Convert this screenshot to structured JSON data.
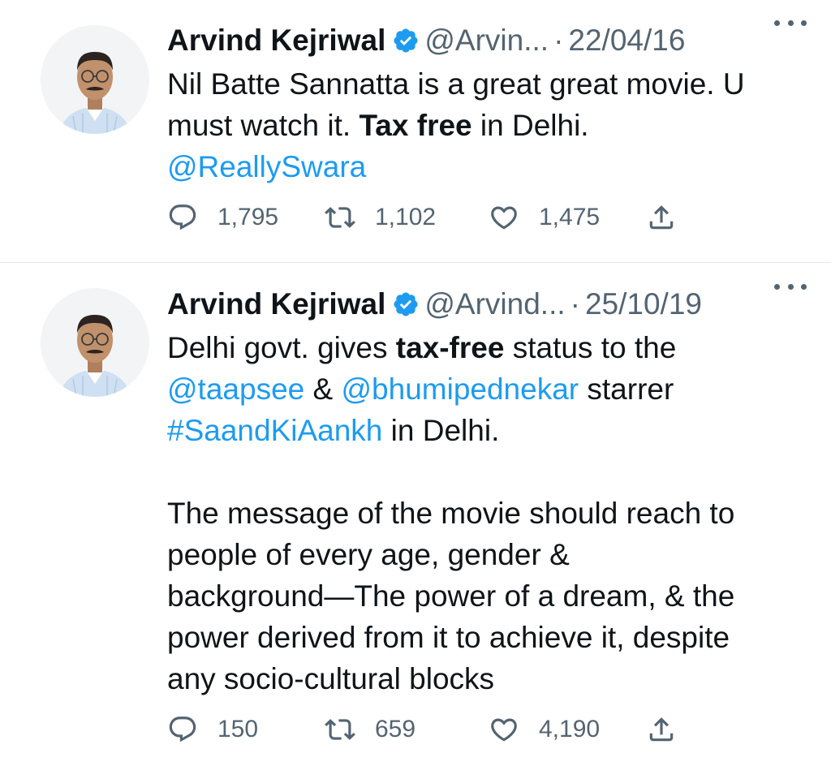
{
  "tweets": [
    {
      "author": {
        "name": "Arvind Kejriwal",
        "handle": "@Arvin...",
        "avatar_icon": "profile-photo-man-glasses-mustache"
      },
      "separator": "·",
      "date": "22/04/16",
      "text": {
        "t1": "Nil Batte Sannatta is a great great movie. U must watch it. ",
        "b1": "Tax free",
        "t2": " in Delhi.",
        "mention": "@ReallySwara"
      },
      "stats": {
        "replies": "1,795",
        "retweets": "1,102",
        "likes": "1,475"
      }
    },
    {
      "author": {
        "name": "Arvind Kejriwal",
        "handle": "@Arvind...",
        "avatar_icon": "profile-photo-man-glasses-mustache"
      },
      "separator": "·",
      "date": "25/10/19",
      "text": {
        "t1": "Delhi govt. gives ",
        "b1": "tax-free",
        "t2": " status to the",
        "mention1": "@taapsee",
        "amp": " & ",
        "mention2": "@bhumipednekar",
        "t3": " starrer",
        "hashtag": "#SaandKiAankh",
        "t4": " in Delhi.",
        "p2_l1": "The message of the movie should reach to",
        "p2_l2": "people of every age, gender &",
        "p2_l3": "background—The power of a dream, & the",
        "p2_l4": "power derived from it to achieve it, despite",
        "p2_l5": "any socio-cultural blocks"
      },
      "stats": {
        "replies": "150",
        "retweets": "659",
        "likes": "4,190"
      }
    }
  ],
  "colors": {
    "text": "#0f1419",
    "secondary": "#536471",
    "link": "#1d9bf0",
    "verified": "#1d9bf0",
    "divider": "#e3e6e8"
  },
  "icons": {
    "verified": "verified-badge-icon",
    "more": "more-options-icon",
    "reply": "reply-bubble-icon",
    "retweet": "retweet-icon",
    "like": "heart-icon",
    "share": "share-upload-icon"
  }
}
